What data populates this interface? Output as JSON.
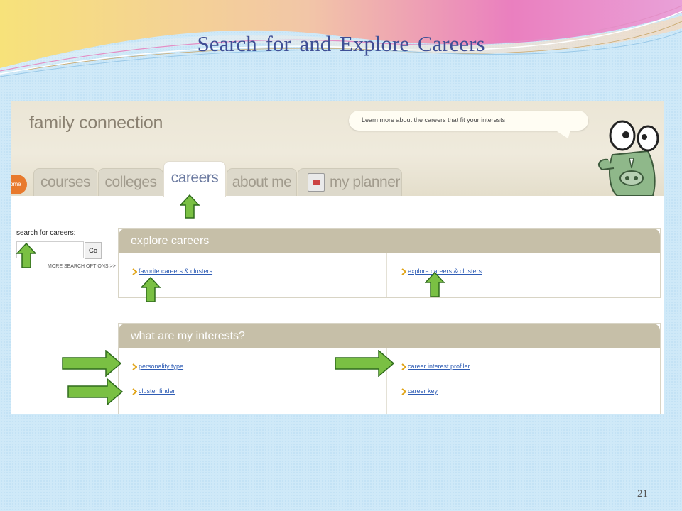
{
  "slide": {
    "title": "Search for and Explore Careers",
    "page_number": "21"
  },
  "site": {
    "brand": "family connection",
    "bubble_text": "Learn more about the careers that fit your interests",
    "home_tab": "ome",
    "tabs": [
      {
        "label": "courses",
        "active": false
      },
      {
        "label": "colleges",
        "active": false
      },
      {
        "label": "careers",
        "active": true
      },
      {
        "label": "about me",
        "active": false
      },
      {
        "label": "my planner",
        "active": false
      }
    ]
  },
  "search": {
    "label": "search for careers:",
    "input_value": "",
    "go_label": "Go",
    "more_options": "MORE SEARCH OPTIONS >>"
  },
  "explore": {
    "heading": "explore careers",
    "links": [
      "favorite careers & clusters",
      "explore careers & clusters"
    ]
  },
  "interests": {
    "heading": "what are my interests?",
    "links": [
      "personality type",
      "career interest profiler",
      "cluster finder",
      "career key"
    ]
  },
  "colors": {
    "title": "#3f4f95",
    "arrow_fill": "#7ac043",
    "arrow_stroke": "#2f6b1c",
    "panel_header": "#c6bfa8",
    "link": "#2f5db5",
    "bullet": "#e0a316"
  }
}
